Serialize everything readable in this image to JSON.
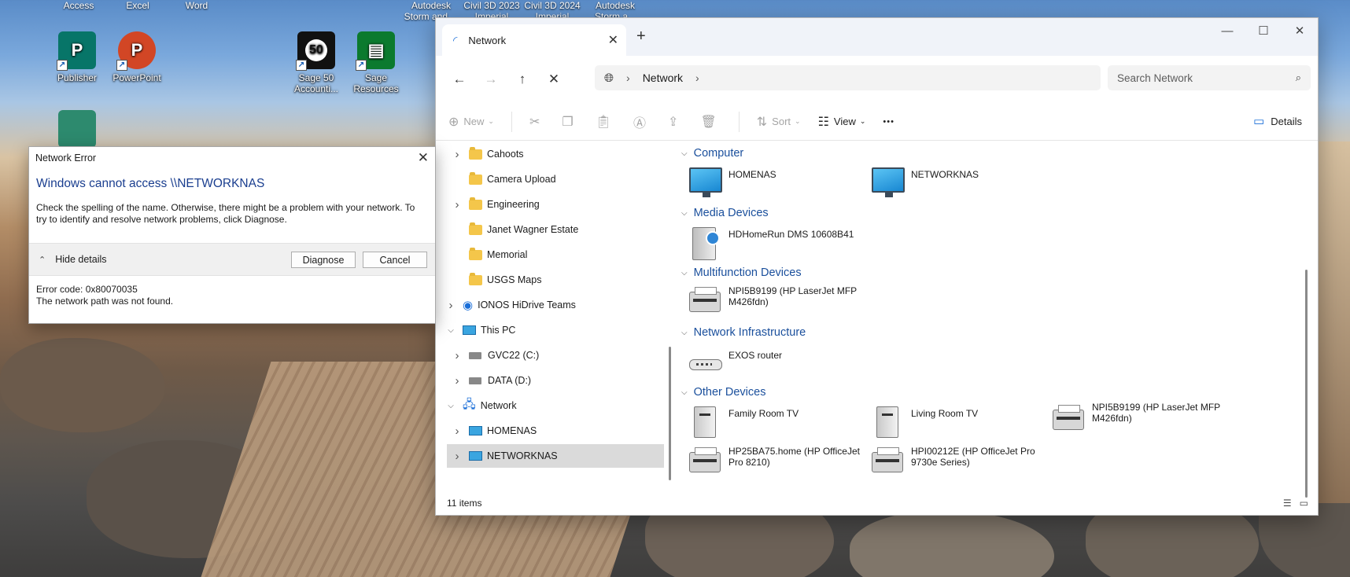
{
  "desktop": {
    "top_labels": [
      "Access",
      "Excel",
      "Word",
      "Autodesk Storm and ...",
      "Civil 3D 2023 Imperial",
      "Civil 3D 2024 Imperial",
      "Autodesk Storm a..."
    ],
    "icons": [
      {
        "label": "Publisher",
        "glyph": "P",
        "color": "#077568"
      },
      {
        "label": "PowerPoint",
        "glyph": "P",
        "color": "#d24625"
      },
      {
        "label": "Sage 50 Accounti...",
        "glyph": "50",
        "color": "#111111"
      },
      {
        "label": "Sage Resources",
        "glyph": "▤",
        "color": "#0b7a2e"
      }
    ]
  },
  "explorer": {
    "tab_title": "Network",
    "new_tab": "+",
    "window_controls": [
      "—",
      "☐",
      "✕"
    ],
    "nav": {
      "back": "←",
      "forward": "→",
      "up": "↑",
      "stop": "✕"
    },
    "address": {
      "location": "Network",
      "sep": "›"
    },
    "search": {
      "placeholder": "Search Network",
      "icon": "⌕"
    },
    "toolbar": {
      "new_label": "New",
      "sort_label": "Sort",
      "view_label": "View",
      "more_label": "•••",
      "details_label": "Details"
    },
    "nav_pane": [
      {
        "label": "Cahoots",
        "type": "folder",
        "chevron": true,
        "indent": 1
      },
      {
        "label": "Camera Upload",
        "type": "folder",
        "chevron": false,
        "indent": 1
      },
      {
        "label": "Engineering",
        "type": "folder",
        "chevron": true,
        "indent": 1
      },
      {
        "label": "Janet Wagner Estate",
        "type": "folder",
        "chevron": false,
        "indent": 1
      },
      {
        "label": "Memorial",
        "type": "folder",
        "chevron": false,
        "indent": 1
      },
      {
        "label": "USGS Maps",
        "type": "folder",
        "chevron": false,
        "indent": 1
      },
      {
        "label": "IONOS HiDrive Teams",
        "type": "cloud",
        "chevron": true,
        "indent": 0
      },
      {
        "label": "This PC",
        "type": "pc",
        "chevron": true,
        "expanded": true,
        "indent": 0
      },
      {
        "label": "GVC22 (C:)",
        "type": "drive",
        "chevron": true,
        "indent": 1
      },
      {
        "label": "DATA (D:)",
        "type": "drive",
        "chevron": true,
        "indent": 1
      },
      {
        "label": "Network",
        "type": "network",
        "chevron": true,
        "expanded": true,
        "indent": 0
      },
      {
        "label": "HOMENAS",
        "type": "pc",
        "chevron": true,
        "indent": 1
      },
      {
        "label": "NETWORKNAS",
        "type": "pc",
        "chevron": true,
        "indent": 1,
        "selected": true
      }
    ],
    "groups": {
      "computer": {
        "header": "Computer",
        "items": [
          "HOMENAS",
          "NETWORKNAS"
        ]
      },
      "media": {
        "header": "Media Devices",
        "items": [
          "HDHomeRun DMS 10608B41"
        ]
      },
      "multifunction": {
        "header": "Multifunction Devices",
        "items": [
          "NPI5B9199 (HP LaserJet MFP M426fdn)"
        ]
      },
      "infrastructure": {
        "header": "Network Infrastructure",
        "items": [
          "EXOS router"
        ]
      },
      "other": {
        "header": "Other Devices",
        "items": [
          "Family Room TV",
          "Living Room TV",
          "NPI5B9199 (HP LaserJet MFP M426fdn)",
          "HP25BA75.home (HP OfficeJet Pro 8210)",
          "HPI00212E (HP OfficeJet Pro 9730e Series)"
        ]
      }
    },
    "status": "11 items"
  },
  "dialog": {
    "title": "Network Error",
    "heading": "Windows cannot access \\\\NETWORKNAS",
    "message": "Check the spelling of the name. Otherwise, there might be a problem with your network. To try to identify and resolve network problems, click Diagnose.",
    "hide_details": "Hide details",
    "diagnose": "Diagnose",
    "cancel": "Cancel",
    "error_code": "Error code: 0x80070035",
    "error_text": "The network path was not found."
  }
}
